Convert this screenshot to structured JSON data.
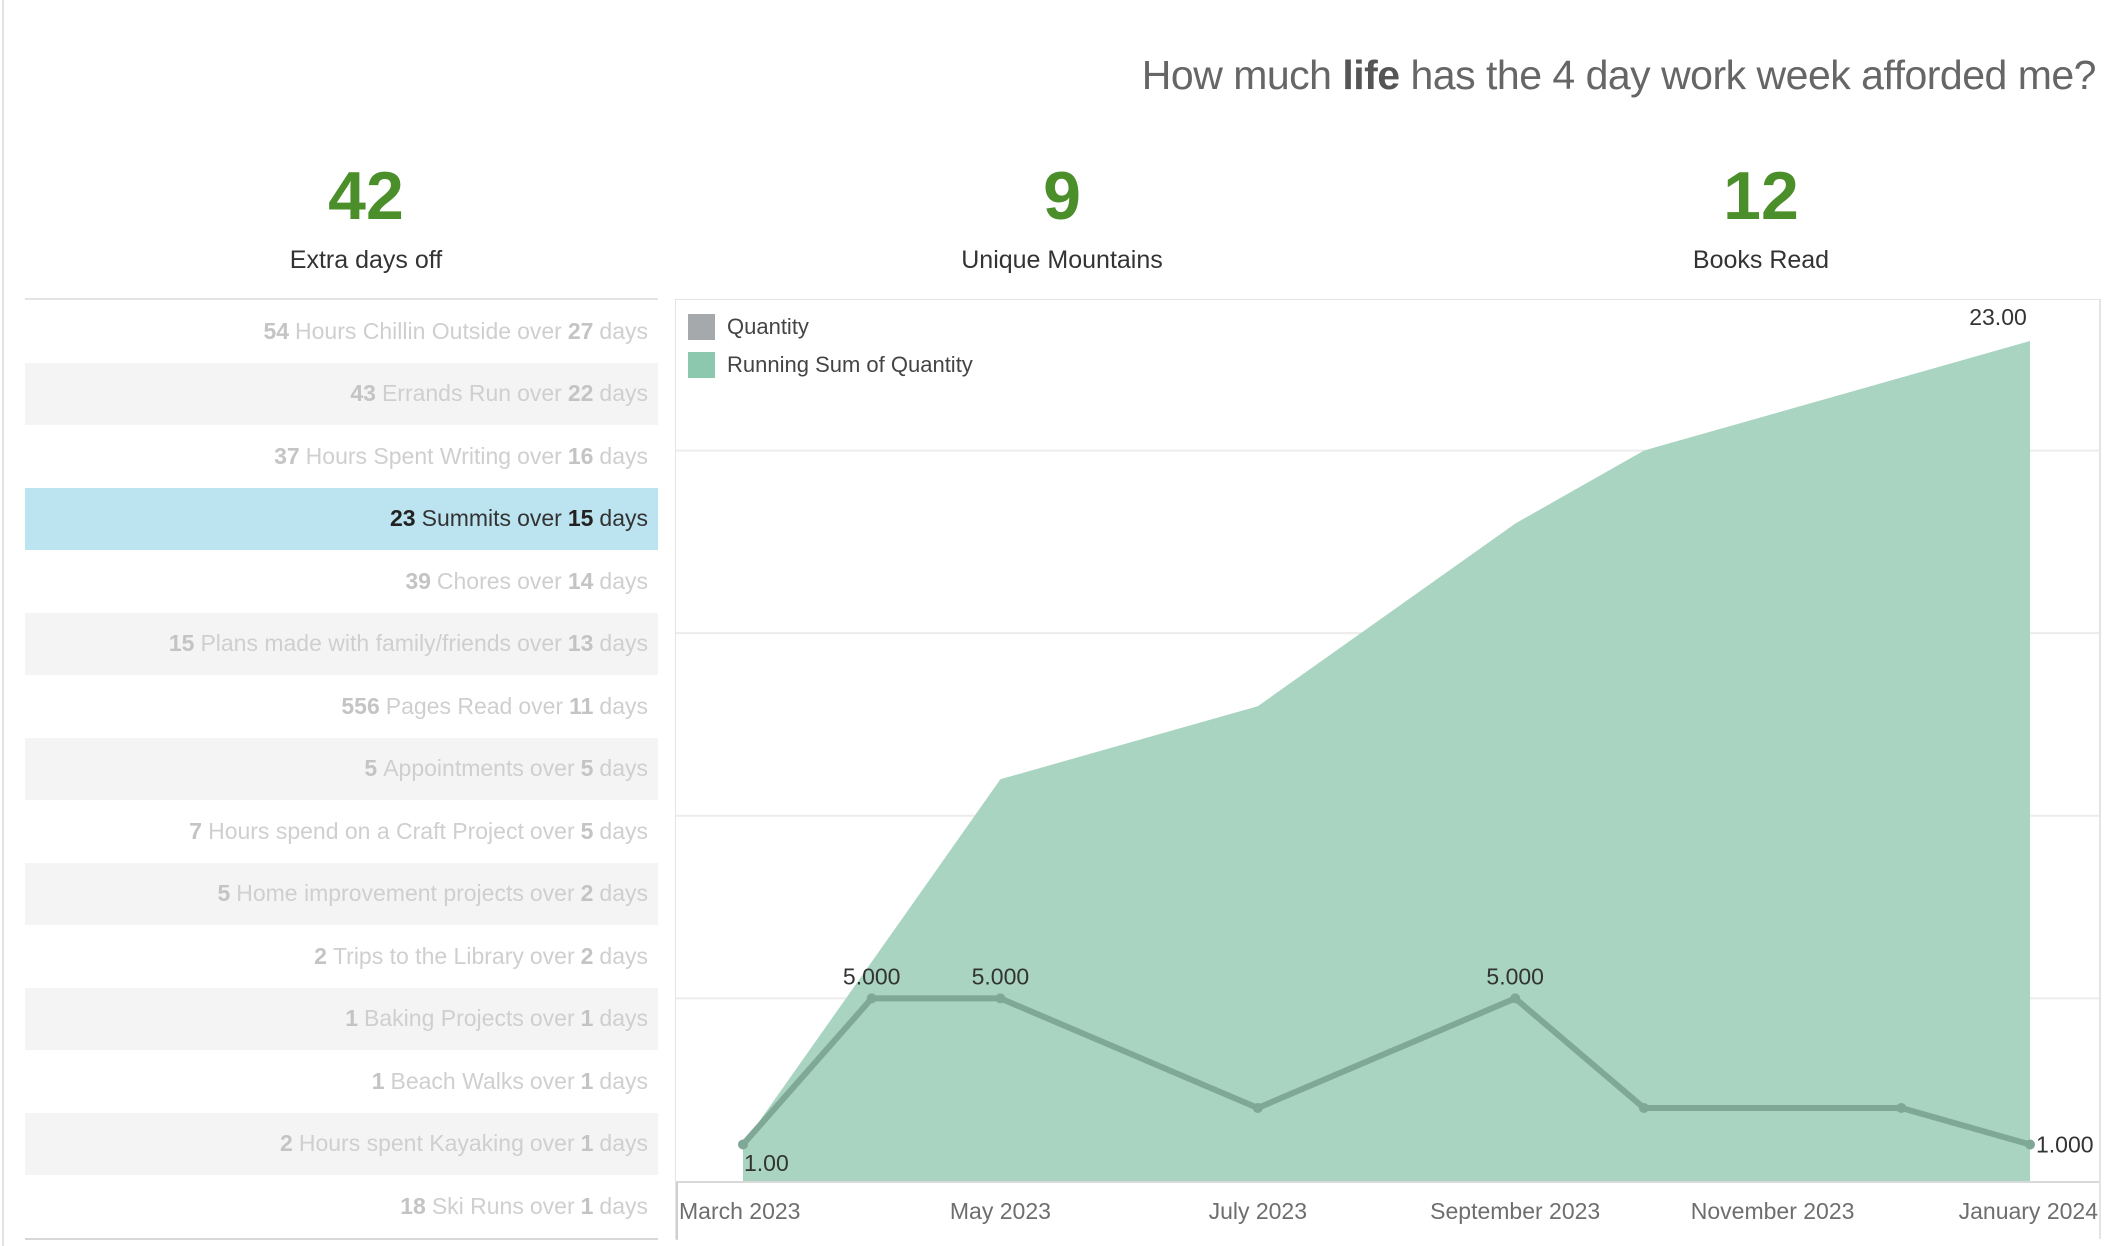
{
  "title": {
    "prefix": "How much ",
    "bold": "life",
    "suffix": " has the 4 day work week afforded me?"
  },
  "kpis": [
    {
      "value": "42",
      "label": "Extra days off"
    },
    {
      "value": "9",
      "label": "Unique Mountains"
    },
    {
      "value": "12",
      "label": "Books Read"
    }
  ],
  "activities": [
    {
      "count": "54",
      "label": "Hours Chillin Outside",
      "days": "27",
      "selected": false
    },
    {
      "count": "43",
      "label": "Errands Run",
      "days": "22",
      "selected": false
    },
    {
      "count": "37",
      "label": "Hours Spent Writing",
      "days": "16",
      "selected": false
    },
    {
      "count": "23",
      "label": "Summits",
      "days": "15",
      "selected": true
    },
    {
      "count": "39",
      "label": "Chores",
      "days": "14",
      "selected": false
    },
    {
      "count": "15",
      "label": "Plans made with family/friends",
      "days": "13",
      "selected": false
    },
    {
      "count": "556",
      "label": "Pages Read",
      "days": "11",
      "selected": false
    },
    {
      "count": "5",
      "label": "Appointments",
      "days": "5",
      "selected": false
    },
    {
      "count": "7",
      "label": "Hours spend on a Craft Project",
      "days": "5",
      "selected": false
    },
    {
      "count": "5",
      "label": "Home improvement projects",
      "days": "2",
      "selected": false
    },
    {
      "count": "2",
      "label": "Trips to the Library",
      "days": "2",
      "selected": false
    },
    {
      "count": "1",
      "label": "Baking Projects",
      "days": "1",
      "selected": false
    },
    {
      "count": "1",
      "label": "Beach Walks",
      "days": "1",
      "selected": false
    },
    {
      "count": "2",
      "label": "Hours spent Kayaking",
      "days": "1",
      "selected": false
    },
    {
      "count": "18",
      "label": "Ski Runs",
      "days": "1",
      "selected": false
    }
  ],
  "row_words": {
    "over": "over",
    "days": "days"
  },
  "chart_data": {
    "type": "area",
    "title": "",
    "xlabel": "",
    "ylabel": "",
    "ylim": [
      0,
      23
    ],
    "grid": true,
    "gridlines": [
      5,
      10,
      15,
      20
    ],
    "legend_position": "top-left",
    "x": [
      "2023-03",
      "2023-04",
      "2023-05",
      "2023-07",
      "2023-09",
      "2023-10",
      "2023-12",
      "2024-01"
    ],
    "x_month_index": [
      0,
      1,
      2,
      4,
      6,
      7,
      9,
      10
    ],
    "x_ticks": [
      {
        "label": "March 2023",
        "month_index": 0
      },
      {
        "label": "May 2023",
        "month_index": 2
      },
      {
        "label": "July 2023",
        "month_index": 4
      },
      {
        "label": "September 2023",
        "month_index": 6
      },
      {
        "label": "November 2023",
        "month_index": 8
      },
      {
        "label": "January 2024",
        "month_index": 10
      }
    ],
    "series": [
      {
        "name": "Quantity",
        "type": "line",
        "color": "#a5a9ab",
        "line_color": "#7fa897",
        "values": [
          1,
          5,
          5,
          2,
          5,
          2,
          2,
          1
        ]
      },
      {
        "name": "Running Sum of Quantity",
        "type": "area",
        "color": "#8bc8ad",
        "fill_color": "#a8d4c1",
        "values": [
          1,
          6,
          11,
          13,
          18,
          20,
          22,
          23
        ]
      }
    ],
    "annotations": [
      {
        "series": "Running Sum of Quantity",
        "index": 0,
        "text": "1.00"
      },
      {
        "series": "Running Sum of Quantity",
        "index": 7,
        "text": "23.00"
      },
      {
        "series": "Quantity",
        "index": 1,
        "text": "5.000"
      },
      {
        "series": "Quantity",
        "index": 2,
        "text": "5.000"
      },
      {
        "series": "Quantity",
        "index": 4,
        "text": "5.000"
      },
      {
        "series": "Quantity",
        "index": 7,
        "text": "1.000"
      }
    ]
  }
}
